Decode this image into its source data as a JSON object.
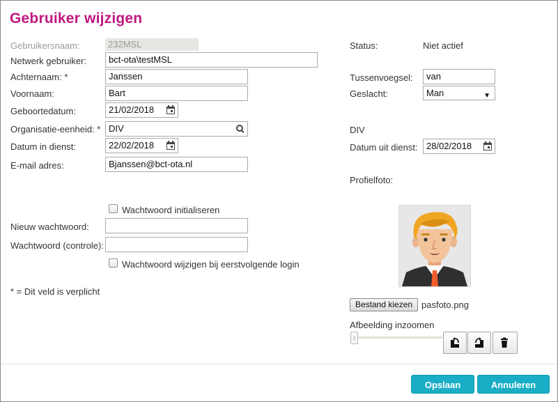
{
  "dialog": {
    "title": "Gebruiker wijzigen",
    "note": "* = Dit veld is verplicht"
  },
  "left": {
    "username": {
      "label": "Gebruikersnaam:",
      "value": "232MSL"
    },
    "network_user": {
      "label": "Netwerk gebruiker:",
      "value": "bct-ota\\testMSL"
    },
    "lastname": {
      "label": "Achternaam: *",
      "value": "Janssen"
    },
    "firstname": {
      "label": "Voornaam:",
      "value": "Bart"
    },
    "birthdate": {
      "label": "Geboortedatum:",
      "value": "21/02/2018"
    },
    "org_unit": {
      "label": "Organisatie-eenheid: *",
      "value": "DIV"
    },
    "start_date": {
      "label": "Datum in dienst:",
      "value": "22/02/2018"
    },
    "email": {
      "label": "E-mail adres:",
      "value": "Bjanssen@bct-ota.nl"
    },
    "reset_password": {
      "label": "Wachtwoord initialiseren",
      "checked": false
    },
    "new_password": {
      "label": "Nieuw wachtwoord:",
      "value": ""
    },
    "confirm_password": {
      "label": "Wachtwoord (controle):",
      "value": ""
    },
    "change_on_login": {
      "label": "Wachtwoord wijzigen bij eerstvolgende login",
      "checked": false
    }
  },
  "right": {
    "status": {
      "label": "Status:",
      "value": "Niet actief"
    },
    "infix": {
      "label": "Tussenvoegsel:",
      "value": "van"
    },
    "gender": {
      "label": "Geslacht:",
      "value": "Man"
    },
    "org_unit_text": "DIV",
    "end_date": {
      "label": "Datum uit dienst:",
      "value": "28/02/2018"
    },
    "photo": {
      "label": "Profielfoto:",
      "choose_button": "Bestand kiezen",
      "filename": "pasfoto.png"
    },
    "zoom": {
      "label": "Afbeelding inzoomen",
      "level": 0
    }
  },
  "footer": {
    "save": "Opslaan",
    "cancel": "Annuleren"
  },
  "colors": {
    "title": "#c0177f",
    "primary_button": "#1aaec6"
  },
  "icons": [
    "calendar-icon",
    "search-icon",
    "rotate-left-icon",
    "rotate-right-icon",
    "trash-icon",
    "chevron-down-icon"
  ]
}
